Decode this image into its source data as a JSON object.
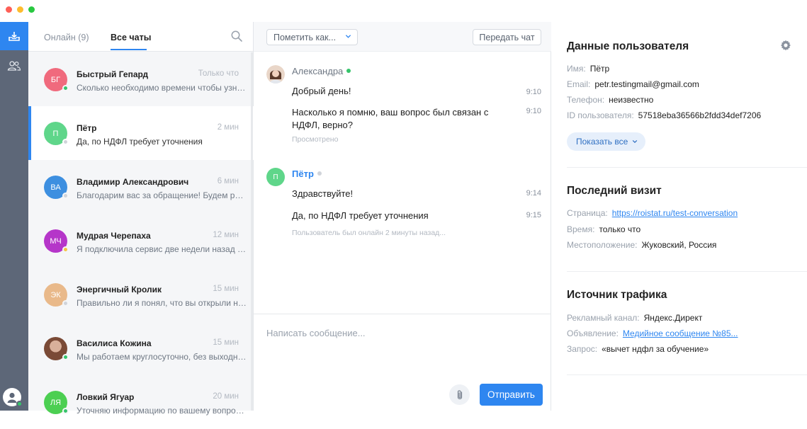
{
  "colors": {
    "accent": "#2e86f0",
    "rail": "#5d6778",
    "online": "#36c46b",
    "offline": "#d0d4da",
    "away": "#f5c542"
  },
  "rail": {
    "icons": [
      "inbox-icon",
      "contacts-icon",
      "user-avatar"
    ]
  },
  "chatlist": {
    "tab_online": "Онлайн (9)",
    "tab_all": "Все чаты",
    "items": [
      {
        "initials": "БГ",
        "name": "Быстрый Гепард",
        "time": "Только что",
        "preview": "Сколько необходимо времени чтобы узнать результат",
        "avatar_color": "#f06a7d",
        "status_color": "#36c46b"
      },
      {
        "initials": "П",
        "name": "Пётр",
        "time": "2 мин",
        "preview": "Да, по НДФЛ требует уточнения",
        "avatar_color": "#5fd68a",
        "status_color": "#d0d4da"
      },
      {
        "initials": "ВА",
        "name": "Владимир Александрович",
        "time": "6 мин",
        "preview": "Благодарим вас за обращение! Будем рады помочь",
        "avatar_color": "#3d8fe0",
        "status_color": "#d0d4da"
      },
      {
        "initials": "МЧ",
        "name": "Мудрая Черепаха",
        "time": "12 мин",
        "preview": "Я подключила сервис две недели назад и хотела бы",
        "avatar_color": "#b536c9",
        "status_color": "#f5c542"
      },
      {
        "initials": "ЭК",
        "name": "Энергичный Кролик",
        "time": "15 мин",
        "preview": "Правильно ли я понял, что вы открыли новый офис",
        "avatar_color": "#e9b98a",
        "status_color": "#d0d4da"
      },
      {
        "initials": "",
        "name": "Василиса Кожина",
        "time": "15 мин",
        "preview": "Мы работаем круглосуточно, без выходных и праздников",
        "avatar_color": "#8a5a44",
        "status_color": "#36c46b"
      },
      {
        "initials": "ЛЯ",
        "name": "Ловкий Ягуар",
        "time": "20 мин",
        "preview": "Уточняю информацию по вашему вопросу, ожидайте",
        "avatar_color": "#4ccf52",
        "status_color": "#36c46b"
      }
    ]
  },
  "conversation": {
    "mark_label": "Пометить как...",
    "transfer_label": "Передать чат",
    "agent_name": "Александра",
    "msg1": "Добрый день!",
    "msg1_time": "9:10",
    "msg2": "Насколько я помню, ваш вопрос был связан с НДФЛ, верно?",
    "msg2_time": "9:10",
    "seen": "Просмотрено",
    "user_initials": "П",
    "user_name": "Пётр",
    "msg3": "Здравствуйте!",
    "msg3_time": "9:14",
    "msg4": "Да, по НДФЛ требует уточнения",
    "msg4_time": "9:15",
    "user_status": "Пользователь был онлайн 2 минуты назад...",
    "input_placeholder": "Написать сообщение...",
    "send_label": "Отправить"
  },
  "info": {
    "user_title": "Данные пользователя",
    "name_label": "Имя:",
    "name_value": "Пётр",
    "email_label": "Email:",
    "email_value": "petr.testingmail@gmail.com",
    "phone_label": "Телефон:",
    "phone_value": "неизвестно",
    "id_label": "ID пользователя:",
    "id_value": "57518eba36566b2fdd34def7206",
    "show_all": "Показать все",
    "visit_title": "Последний визит",
    "page_label": "Страница:",
    "page_value": "https://roistat.ru/test-conversation",
    "time_label": "Время:",
    "time_value": "только что",
    "location_label": "Местоположение:",
    "location_value": "Жуковский, Россия",
    "traffic_title": "Источник трафика",
    "channel_label": "Рекламный канал:",
    "channel_value": "Яндекс.Директ",
    "ad_label": "Объявление:",
    "ad_value": "Медийное сообщение №85...",
    "query_label": "Запрос:",
    "query_value": "«вычет ндфл за обучение»"
  }
}
